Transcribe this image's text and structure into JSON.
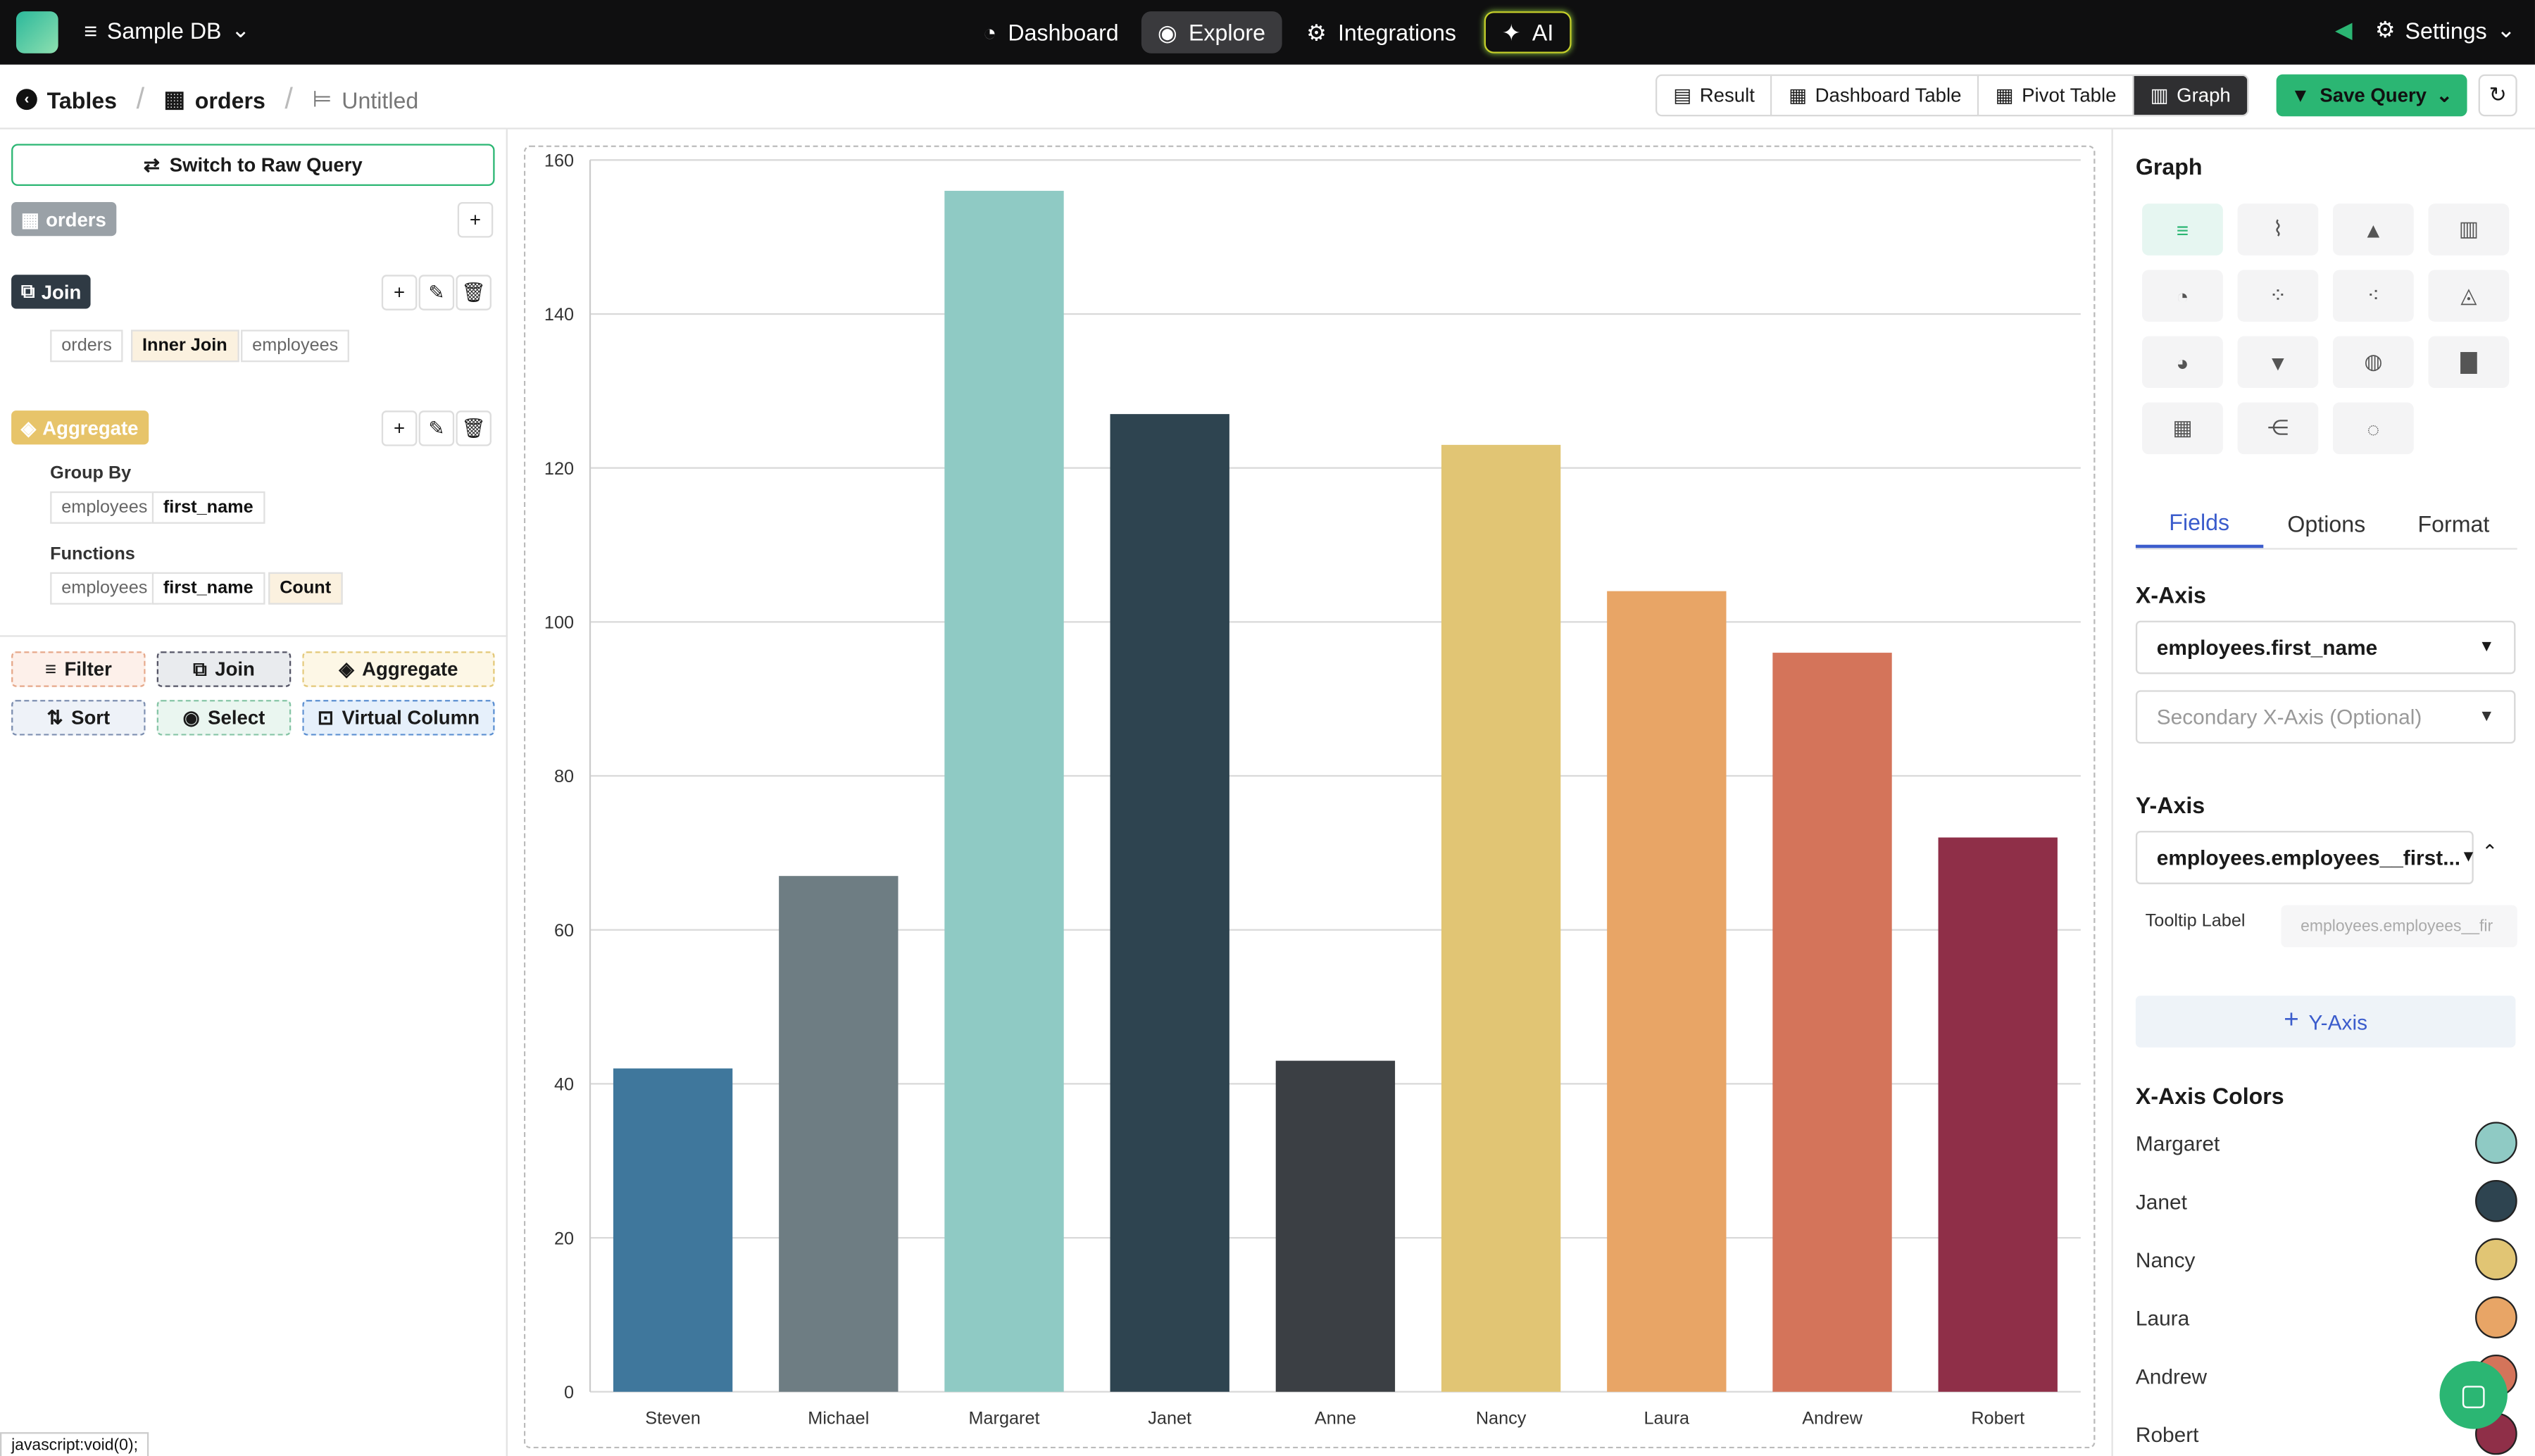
{
  "topbar": {
    "db": "Sample DB",
    "nav": [
      "Dashboard",
      "Explore",
      "Integrations",
      "AI"
    ],
    "settings": "Settings"
  },
  "breadcrumb": [
    "Tables",
    "orders",
    "Untitled"
  ],
  "views": [
    "Result",
    "Dashboard Table",
    "Pivot Table",
    "Graph"
  ],
  "save_label": "Save Query",
  "left": {
    "raw": "Switch to Raw Query",
    "table": "orders",
    "join": "Join",
    "join_chips": [
      "orders",
      "Inner Join",
      "employees"
    ],
    "aggregate": "Aggregate",
    "group_by": "Group By",
    "group_chips": [
      "employees",
      "first_name"
    ],
    "functions": "Functions",
    "function_chips": [
      "employees",
      "first_name",
      "Count"
    ],
    "ops": [
      "Filter",
      "Join",
      "Aggregate",
      "Sort",
      "Select",
      "Virtual Column"
    ]
  },
  "right": {
    "title": "Graph",
    "tabs": [
      "Fields",
      "Options",
      "Format"
    ],
    "xaxis_label": "X-Axis",
    "xaxis_value": "employees.first_name",
    "secondary": "Secondary X-Axis (Optional)",
    "yaxis_label": "Y-Axis",
    "yaxis_value": "employees.employees__first...",
    "tooltip_label": "Tooltip Label",
    "tooltip_placeholder": "employees.employees__fir",
    "add_y": "Y-Axis",
    "colors_title": "X-Axis Colors",
    "color_rows": [
      {
        "name": "Margaret",
        "color": "#8fcac4"
      },
      {
        "name": "Janet",
        "color": "#2e4450"
      },
      {
        "name": "Nancy",
        "color": "#e1c574"
      },
      {
        "name": "Laura",
        "color": "#e8a566"
      },
      {
        "name": "Andrew",
        "color": "#d4745a"
      },
      {
        "name": "Robert",
        "color": "#8f2f48"
      }
    ]
  },
  "status": "javascript:void(0);",
  "chart_data": {
    "type": "bar",
    "categories": [
      "Steven",
      "Michael",
      "Margaret",
      "Janet",
      "Anne",
      "Nancy",
      "Laura",
      "Andrew",
      "Robert"
    ],
    "values": [
      42,
      67,
      156,
      127,
      43,
      123,
      104,
      96,
      72
    ],
    "colors": [
      "#3f779c",
      "#6e7d83",
      "#8fcac4",
      "#2e4450",
      "#3b3f44",
      "#e1c574",
      "#e8a566",
      "#d4745a",
      "#8f2f48"
    ],
    "yticks": [
      0,
      20,
      40,
      60,
      80,
      100,
      120,
      140,
      160
    ],
    "ylim": [
      0,
      160
    ],
    "grid": true
  }
}
